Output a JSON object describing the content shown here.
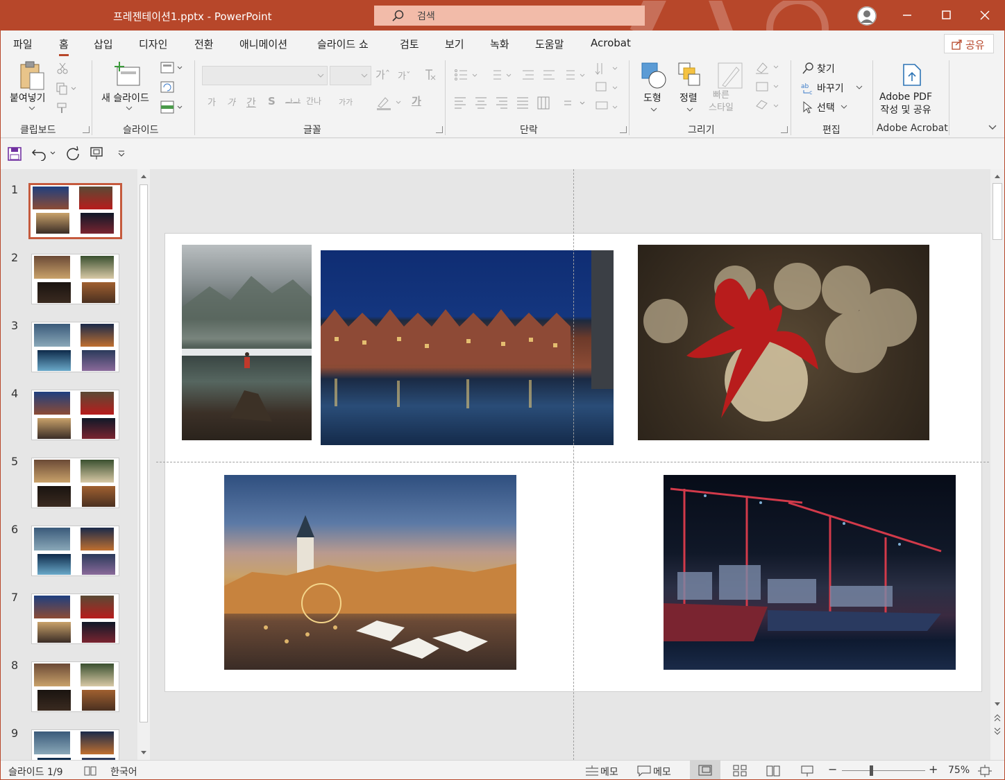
{
  "window": {
    "title": "프레젠테이션1.pptx  -  PowerPoint",
    "search_placeholder": "검색",
    "accent": "#b7472a"
  },
  "tabs": [
    "파일",
    "홈",
    "삽입",
    "디자인",
    "전환",
    "애니메이션",
    "슬라이드 쇼",
    "검토",
    "보기",
    "녹화",
    "도움말",
    "Acrobat"
  ],
  "active_tab": "홈",
  "share_label": "공유",
  "ribbon": {
    "clipboard": {
      "paste": "붙여넣기",
      "group": "클립보드"
    },
    "slides": {
      "new_slide": "새 슬라이드",
      "group": "슬라이드"
    },
    "font": {
      "group": "글꼴",
      "grow": "가ˆ",
      "shrink": "가ˇ",
      "bold": "가",
      "italic": "가",
      "underline": "간",
      "shadow": "S",
      "strike": "ᆉᆉ",
      "spacing": "간나",
      "case": "가가",
      "font_color": "가"
    },
    "paragraph": {
      "group": "단락"
    },
    "drawing": {
      "shapes": "도형",
      "arrange": "정렬",
      "quick_styles": "빠른\n스타일",
      "group": "그리기"
    },
    "editing": {
      "find": "찾기",
      "replace": "바꾸기",
      "select": "선택",
      "group": "편집"
    },
    "acrobat": {
      "create_pdf": "Adobe PDF\n작성 및 공유",
      "group": "Adobe Acrobat"
    }
  },
  "thumbnails": [
    {
      "num": "1",
      "set": "A"
    },
    {
      "num": "2",
      "set": "B"
    },
    {
      "num": "3",
      "set": "C"
    },
    {
      "num": "4",
      "set": "A"
    },
    {
      "num": "5",
      "set": "B"
    },
    {
      "num": "6",
      "set": "C"
    },
    {
      "num": "7",
      "set": "A"
    },
    {
      "num": "8",
      "set": "B"
    },
    {
      "num": "9",
      "set": "C"
    }
  ],
  "slide_photos": [
    {
      "name": "mountain-lake-photo",
      "subject": "hiker at mountain lake"
    },
    {
      "name": "harbor-houses-photo",
      "subject": "brick houses reflected at night"
    },
    {
      "name": "ribbon-ornament-photo",
      "subject": "red ribbon on glowing light ball"
    },
    {
      "name": "christmas-market-photo",
      "subject": "town square christmas market at dusk"
    },
    {
      "name": "container-port-photo",
      "subject": "container ship at night port"
    }
  ],
  "status": {
    "slide_indicator": "슬라이드 1/9",
    "language": "한국어",
    "notes": "메모",
    "comments": "메모",
    "zoom": "75%"
  }
}
